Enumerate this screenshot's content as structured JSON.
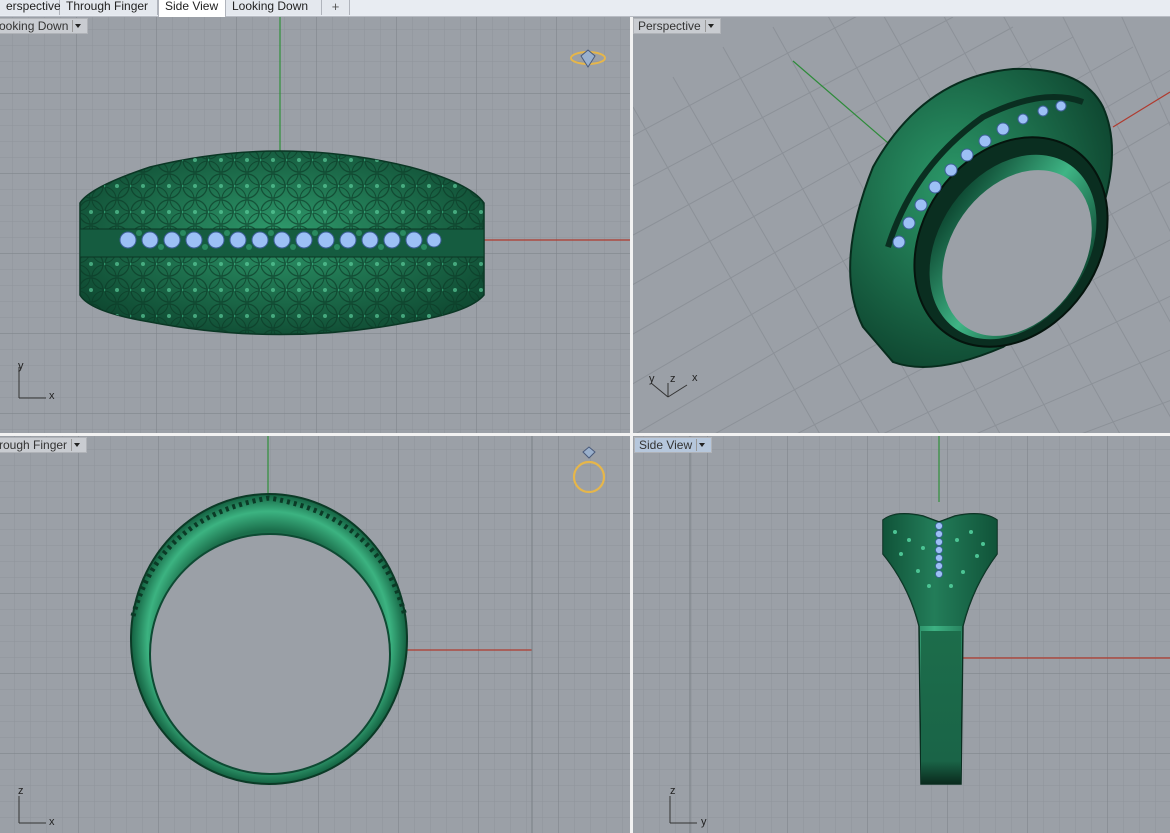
{
  "tabs": [
    {
      "label": "erspective",
      "active": false
    },
    {
      "label": "Through Finger",
      "active": false
    },
    {
      "label": "Side View",
      "active": true
    },
    {
      "label": "Looking Down",
      "active": false
    }
  ],
  "add_tab_glyph": "+",
  "viewports": {
    "top_left": {
      "label": "ooking Down",
      "axes": {
        "vertical": "y",
        "horizontal": "x"
      }
    },
    "top_right": {
      "label": "Perspective",
      "axes": {
        "a": "y",
        "b": "z",
        "c": "x"
      }
    },
    "bottom_left": {
      "label": "rough Finger",
      "axes": {
        "vertical": "z",
        "horizontal": "x"
      }
    },
    "bottom_right": {
      "label": "Side View",
      "active": true,
      "axes": {
        "vertical": "z",
        "horizontal": "y"
      }
    }
  },
  "icons": {
    "ring_icon": "ring-with-diamond-icon"
  },
  "colors": {
    "viewport_bg": "#9ba0a7",
    "grid_minor": "#8e939a",
    "grid_major": "#7e838a",
    "ring_green": "#1f7a55",
    "gem_blue": "#8fb4f0",
    "x_axis": "#b03a2e",
    "y_axis": "#2e8b3a",
    "icon_gold": "#e6b64a"
  }
}
